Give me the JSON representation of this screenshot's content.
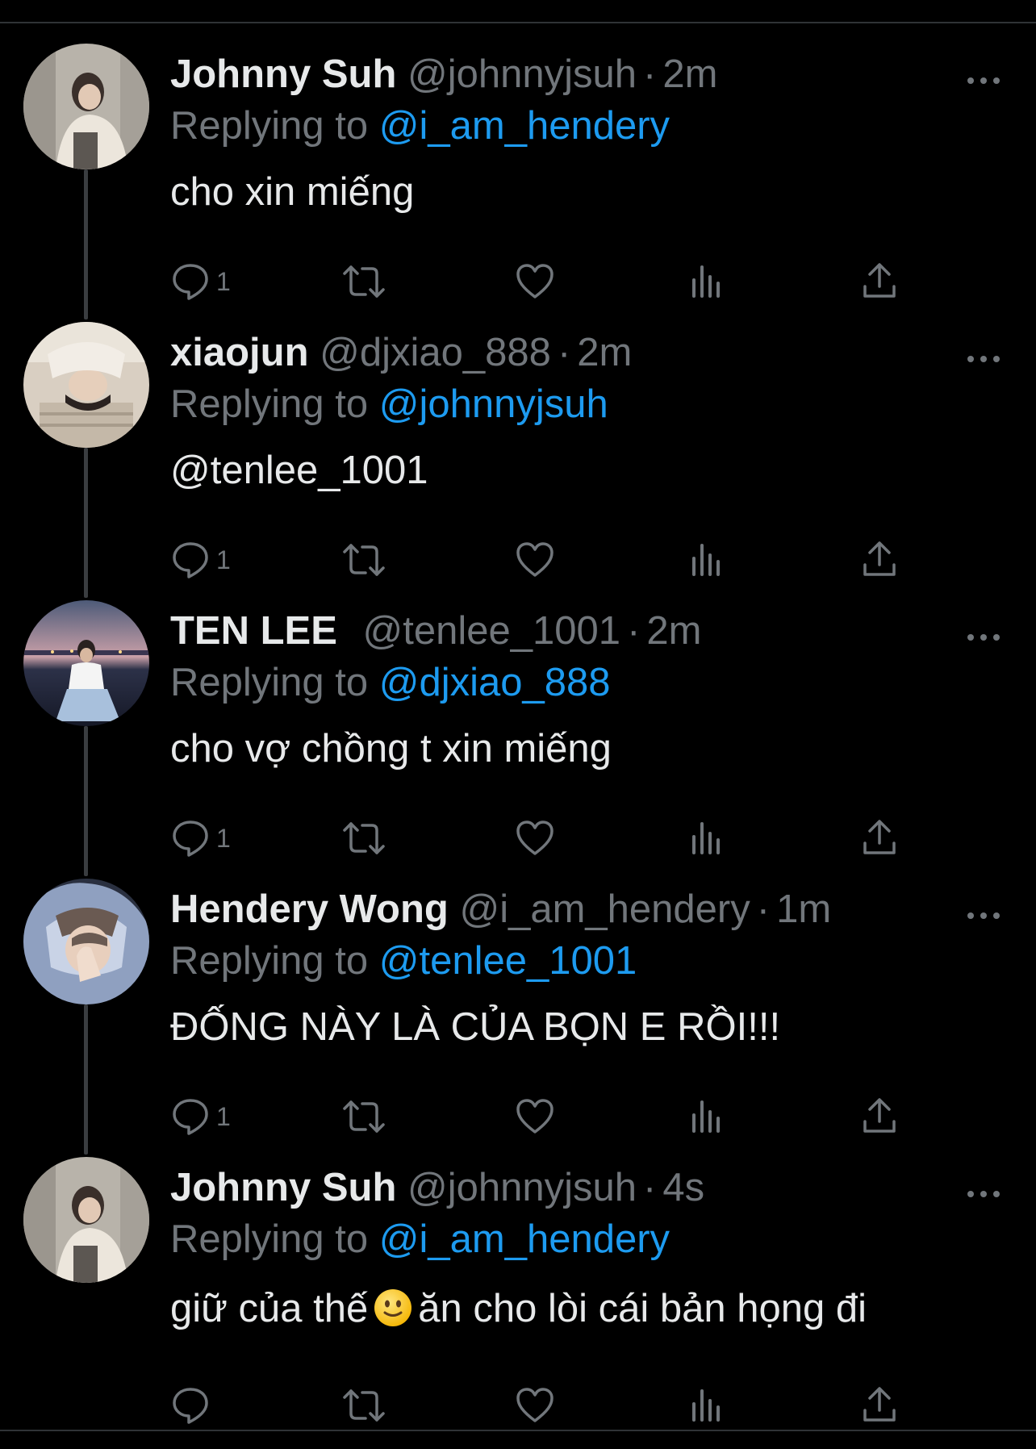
{
  "colors": {
    "background": "#000000",
    "text_primary": "#e7e9ea",
    "text_secondary": "#71767b",
    "accent": "#1d9bf0",
    "divider": "#2f3336",
    "thread_line": "#3a3d40"
  },
  "reply_prefix": "Replying to",
  "separator": "·",
  "tweets": [
    {
      "display_name": "Johnny Suh",
      "handle": "@johnnyjsuh",
      "time": "2m",
      "replying_to": "@i_am_hendery",
      "text": "cho xin miếng",
      "reply_count": "1",
      "avatar_icon": "avatar-johnny"
    },
    {
      "display_name": "xiaojun",
      "handle": "@djxiao_888",
      "time": "2m",
      "replying_to": "@johnnyjsuh",
      "text": "@tenlee_1001",
      "reply_count": "1",
      "avatar_icon": "avatar-xiaojun"
    },
    {
      "display_name": "TEN LEE",
      "handle": "@tenlee_1001",
      "time": "2m",
      "replying_to": "@djxiao_888",
      "text": "cho vợ chồng t xin miếng",
      "reply_count": "1",
      "avatar_icon": "avatar-ten"
    },
    {
      "display_name": "Hendery Wong",
      "handle": "@i_am_hendery",
      "time": "1m",
      "replying_to": "@tenlee_1001",
      "text": "ĐỐNG NÀY LÀ CỦA BỌN E RỒI!!!",
      "reply_count": "1",
      "avatar_icon": "avatar-hendery"
    },
    {
      "display_name": "Johnny Suh",
      "handle": "@johnnyjsuh",
      "time": "4s",
      "replying_to": "@i_am_hendery",
      "text_before_emoji": "giữ của thế",
      "emoji": "slightly-smiling-face-emoji",
      "text_after_emoji": "ăn cho lòi cái bản họng đi",
      "reply_count": "",
      "avatar_icon": "avatar-johnny"
    }
  ]
}
